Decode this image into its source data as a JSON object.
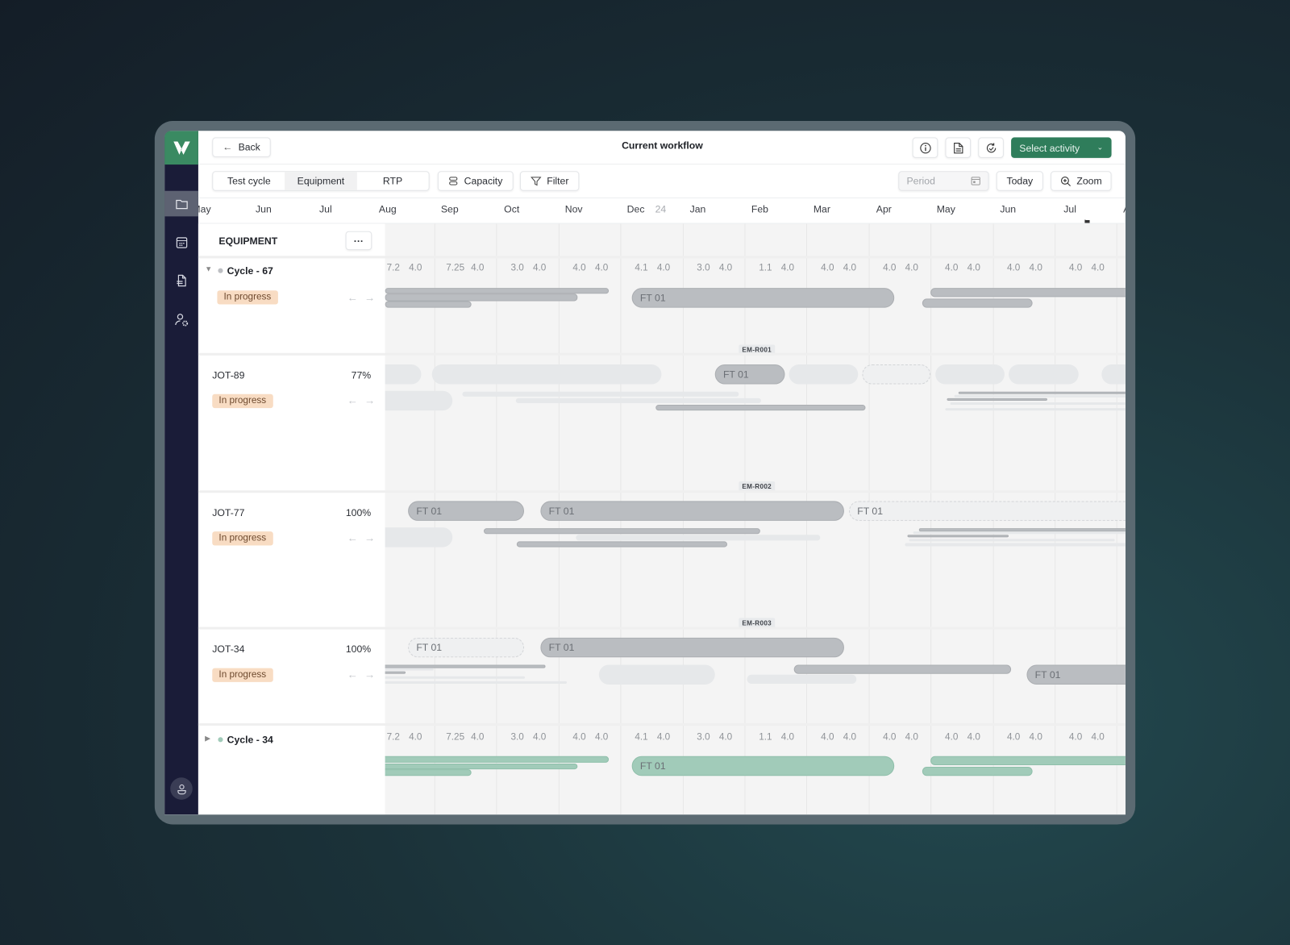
{
  "header": {
    "back_label": "Back",
    "title": "Current workflow",
    "select_activity_label": "Select activity"
  },
  "toolbar": {
    "tabs": [
      {
        "label": "Test cycle"
      },
      {
        "label": "Equipment",
        "active": true
      },
      {
        "label": "RTP"
      }
    ],
    "capacity_label": "Capacity",
    "filter_label": "Filter",
    "period_placeholder": "Period",
    "today_label": "Today",
    "zoom_label": "Zoom"
  },
  "timeline": {
    "months": [
      "May",
      "Jun",
      "Jul",
      "Aug",
      "Sep",
      "Oct",
      "Nov",
      "Dec",
      "Jan",
      "Feb",
      "Mar",
      "Apr",
      "May",
      "Jun",
      "Jul",
      "Aug"
    ],
    "year_marker": "24",
    "values": [
      [
        "7.2",
        "4.0"
      ],
      [
        "7.25",
        "4.0"
      ],
      [
        "3.0",
        "4.0"
      ],
      [
        "4.0",
        "4.0"
      ],
      [
        "4.1",
        "4.0"
      ],
      [
        "3.0",
        "4.0"
      ],
      [
        "1.1",
        "4.0"
      ],
      [
        "4.0",
        "4.0"
      ],
      [
        "4.0",
        "4.0"
      ],
      [
        "4.0",
        "4.0"
      ],
      [
        "4.0",
        "4.0"
      ],
      [
        "4.0",
        "4.0"
      ]
    ],
    "bar_label": "FT 01",
    "resources": [
      "EM-R001",
      "EM-R002",
      "EM-R003"
    ]
  },
  "panel": {
    "title": "EQUIPMENT",
    "more_label": "···"
  },
  "rows": [
    {
      "name": "Cycle - 67",
      "type": "cycle",
      "expanded": true,
      "status": "In progress"
    },
    {
      "name": "JOT-89",
      "percent": "77%",
      "status": "In progress"
    },
    {
      "name": "JOT-77",
      "percent": "100%",
      "status": "In progress"
    },
    {
      "name": "JOT-34",
      "percent": "100%",
      "status": "In progress"
    },
    {
      "name": "Cycle - 34",
      "type": "cycle",
      "expanded": false
    }
  ],
  "colors": {
    "brand": "#3a8a62",
    "sidebar": "#1a1c38",
    "status_badge": "#f8dcc3",
    "cycle_34_bars": "#a1cbb9",
    "bars": "#babdc1"
  }
}
